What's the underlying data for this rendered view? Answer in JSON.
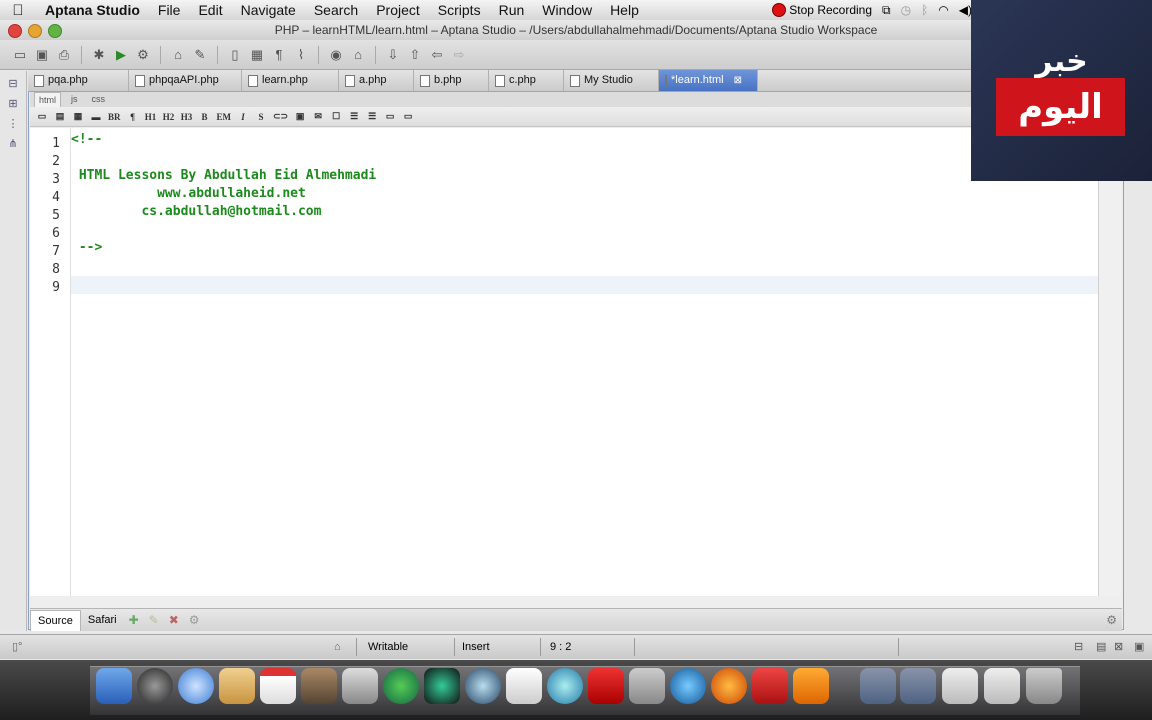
{
  "menubar": {
    "app_name": "Aptana Studio",
    "items": [
      "File",
      "Edit",
      "Navigate",
      "Search",
      "Project",
      "Scripts",
      "Run",
      "Window",
      "Help"
    ],
    "stop_recording": "Stop Recording"
  },
  "window": {
    "title": "PHP – learnHTML/learn.html – Aptana Studio – /Users/abdullahalmehmadi/Documents/Aptana Studio Workspace"
  },
  "editor_tabs": [
    {
      "label": "pqa.php"
    },
    {
      "label": "phpqaAPI.php"
    },
    {
      "label": "learn.php"
    },
    {
      "label": "a.php"
    },
    {
      "label": "b.php"
    },
    {
      "label": "c.php"
    },
    {
      "label": "My Studio"
    },
    {
      "label": "*learn.html",
      "active": true
    }
  ],
  "lang_tabs": [
    "html",
    "js",
    "css"
  ],
  "html_tools": [
    "BR",
    "¶",
    "H1",
    "H2",
    "H3",
    "B",
    "EM",
    "I",
    "S"
  ],
  "code": {
    "line_numbers": [
      "1",
      "2",
      "3",
      "4",
      "5",
      "6",
      "7",
      "8",
      "9"
    ],
    "lines": [
      "<!--",
      "",
      " HTML Lessons By Abdullah Eid Almehmadi",
      "           www.abdullaheid.net",
      "         cs.abdullah@hotmail.com",
      "",
      " -->",
      "",
      ""
    ],
    "current_line": 9,
    "text_color": "#1d8a1d"
  },
  "bottom_tabs": [
    "Source",
    "Safari"
  ],
  "statusbar": {
    "mode": "Writable",
    "insert": "Insert",
    "position": "9 : 2"
  },
  "overlay": {
    "line1": "خبر",
    "line2": "اليوم"
  },
  "colors": {
    "active_tab": "#4873c4",
    "logo_red": "#d0141b",
    "logo_bg": "#2b3656"
  }
}
